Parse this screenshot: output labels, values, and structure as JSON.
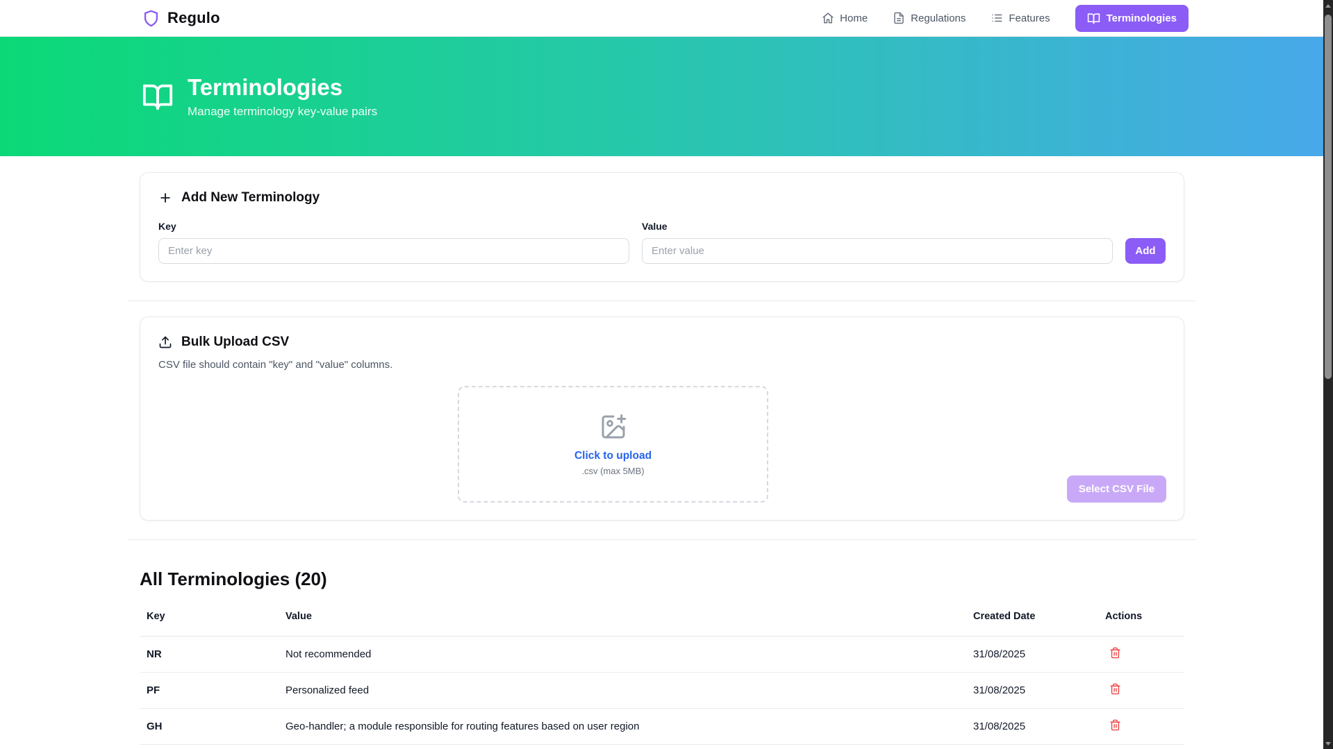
{
  "brand": {
    "name": "Regulo"
  },
  "nav": {
    "items": [
      {
        "icon": "home-icon",
        "label": "Home"
      },
      {
        "icon": "file-text-icon",
        "label": "Regulations"
      },
      {
        "icon": "list-icon",
        "label": "Features"
      }
    ],
    "active": {
      "icon": "book-open-icon",
      "label": "Terminologies"
    }
  },
  "hero": {
    "icon": "book-open-icon",
    "title": "Terminologies",
    "subtitle": "Manage terminology key-value pairs"
  },
  "add_form": {
    "icon": "plus-icon",
    "title": "Add New Terminology",
    "key_label": "Key",
    "key_placeholder": "Enter key",
    "value_label": "Value",
    "value_placeholder": "Enter value",
    "add_label": "Add"
  },
  "bulk": {
    "icon": "upload-icon",
    "title": "Bulk Upload CSV",
    "description": "CSV file should contain \"key\" and \"value\" columns.",
    "dropzone_icon": "image-plus-icon",
    "click_to_upload": "Click to upload",
    "file_hint": ".csv (max 5MB)",
    "select_button": "Select CSV File"
  },
  "table": {
    "title": "All Terminologies (20)",
    "headers": [
      "Key",
      "Value",
      "Created Date",
      "Actions"
    ],
    "rows": [
      {
        "key": "NR",
        "value": "Not recommended",
        "created": "31/08/2025"
      },
      {
        "key": "PF",
        "value": "Personalized feed",
        "created": "31/08/2025"
      },
      {
        "key": "GH",
        "value": "Geo-handler; a module responsible for routing features based on user region",
        "created": "31/08/2025"
      }
    ],
    "row_action_icon": "trash-icon"
  },
  "colors": {
    "accent_purple": "#8b5cf6",
    "accent_purple_disabled": "#c9a9f7",
    "hero_gradient_start": "#0bd977",
    "hero_gradient_end": "#48a8eb",
    "link_blue": "#2563eb",
    "danger_red": "#ef4444"
  }
}
